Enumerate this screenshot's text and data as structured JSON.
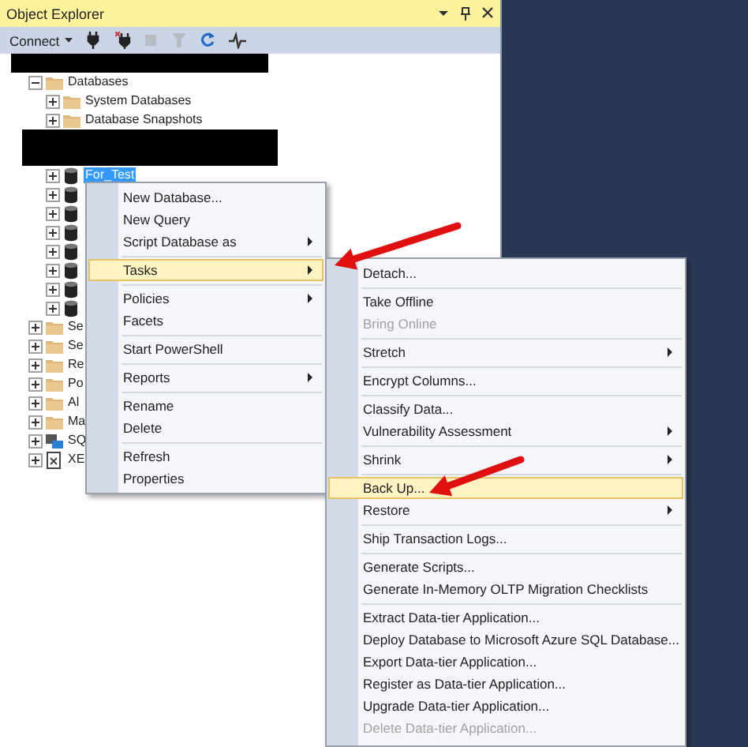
{
  "panel": {
    "title": "Object Explorer"
  },
  "toolbar": {
    "connect": "Connect"
  },
  "tree": [
    {
      "kind": "redacted",
      "children": [
        {
          "kind": "folder",
          "label": "Databases",
          "expanded": true,
          "selected": false,
          "children": [
            {
              "kind": "folder",
              "label": "System Databases",
              "expanded": false,
              "selected": false
            },
            {
              "kind": "folder",
              "label": "Database Snapshots",
              "expanded": false,
              "selected": false
            },
            {
              "kind": "redacted-block"
            },
            {
              "kind": "database",
              "label": "For_Test",
              "expanded": false,
              "selected": true
            },
            {
              "kind": "database",
              "expanded": false
            },
            {
              "kind": "database",
              "expanded": false
            },
            {
              "kind": "database",
              "expanded": false
            },
            {
              "kind": "database",
              "expanded": false
            },
            {
              "kind": "database",
              "expanded": false
            },
            {
              "kind": "database",
              "expanded": false
            },
            {
              "kind": "database",
              "expanded": false
            }
          ]
        },
        {
          "kind": "folder",
          "label": "Se",
          "expanded": false,
          "selected": false
        },
        {
          "kind": "folder",
          "label": "Se",
          "expanded": false,
          "selected": false
        },
        {
          "kind": "folder",
          "label": "Re",
          "expanded": false,
          "selected": false
        },
        {
          "kind": "folder",
          "label": "Po",
          "expanded": false,
          "selected": false
        },
        {
          "kind": "folder",
          "label": "Al",
          "expanded": false,
          "selected": false
        },
        {
          "kind": "folder",
          "label": "Ma",
          "expanded": false,
          "selected": false
        },
        {
          "kind": "agent",
          "label": "SQ",
          "expanded": false,
          "selected": false
        },
        {
          "kind": "xevent",
          "label": "XE",
          "expanded": false,
          "selected": false
        }
      ]
    }
  ],
  "context_menu": {
    "groups": [
      [
        {
          "label": "New Database...",
          "submenu": false,
          "selected": false,
          "disabled": false
        },
        {
          "label": "New Query",
          "submenu": false,
          "selected": false,
          "disabled": false
        },
        {
          "label": "Script Database as",
          "submenu": true,
          "selected": false,
          "disabled": false
        }
      ],
      [
        {
          "label": "Tasks",
          "submenu": true,
          "selected": true,
          "disabled": false
        }
      ],
      [
        {
          "label": "Policies",
          "submenu": true,
          "selected": false,
          "disabled": false
        },
        {
          "label": "Facets",
          "submenu": false,
          "selected": false,
          "disabled": false
        }
      ],
      [
        {
          "label": "Start PowerShell",
          "submenu": false,
          "selected": false,
          "disabled": false
        }
      ],
      [
        {
          "label": "Reports",
          "submenu": true,
          "selected": false,
          "disabled": false
        }
      ],
      [
        {
          "label": "Rename",
          "submenu": false,
          "selected": false,
          "disabled": false
        },
        {
          "label": "Delete",
          "submenu": false,
          "selected": false,
          "disabled": false
        }
      ],
      [
        {
          "label": "Refresh",
          "submenu": false,
          "selected": false,
          "disabled": false
        },
        {
          "label": "Properties",
          "submenu": false,
          "selected": false,
          "disabled": false
        }
      ]
    ]
  },
  "tasks_submenu": {
    "groups": [
      [
        {
          "label": "Detach...",
          "submenu": false,
          "selected": false,
          "disabled": false
        }
      ],
      [
        {
          "label": "Take Offline",
          "submenu": false,
          "selected": false,
          "disabled": false
        },
        {
          "label": "Bring Online",
          "submenu": false,
          "selected": false,
          "disabled": true
        }
      ],
      [
        {
          "label": "Stretch",
          "submenu": true,
          "selected": false,
          "disabled": false
        }
      ],
      [
        {
          "label": "Encrypt Columns...",
          "submenu": false,
          "selected": false,
          "disabled": false
        }
      ],
      [
        {
          "label": "Classify Data...",
          "submenu": false,
          "selected": false,
          "disabled": false
        },
        {
          "label": "Vulnerability Assessment",
          "submenu": true,
          "selected": false,
          "disabled": false
        }
      ],
      [
        {
          "label": "Shrink",
          "submenu": true,
          "selected": false,
          "disabled": false
        }
      ],
      [
        {
          "label": "Back Up...",
          "submenu": false,
          "selected": true,
          "disabled": false
        },
        {
          "label": "Restore",
          "submenu": true,
          "selected": false,
          "disabled": false
        }
      ],
      [
        {
          "label": "Ship Transaction Logs...",
          "submenu": false,
          "selected": false,
          "disabled": false
        }
      ],
      [
        {
          "label": "Generate Scripts...",
          "submenu": false,
          "selected": false,
          "disabled": false
        },
        {
          "label": "Generate In-Memory OLTP Migration Checklists",
          "submenu": false,
          "selected": false,
          "disabled": false
        }
      ],
      [
        {
          "label": "Extract Data-tier Application...",
          "submenu": false,
          "selected": false,
          "disabled": false
        },
        {
          "label": "Deploy Database to Microsoft Azure SQL Database...",
          "submenu": false,
          "selected": false,
          "disabled": false
        },
        {
          "label": "Export Data-tier Application...",
          "submenu": false,
          "selected": false,
          "disabled": false
        },
        {
          "label": "Register as Data-tier Application...",
          "submenu": false,
          "selected": false,
          "disabled": false
        },
        {
          "label": "Upgrade Data-tier Application...",
          "submenu": false,
          "selected": false,
          "disabled": false
        },
        {
          "label": "Delete Data-tier Application...",
          "submenu": false,
          "selected": false,
          "disabled": true
        }
      ]
    ]
  }
}
